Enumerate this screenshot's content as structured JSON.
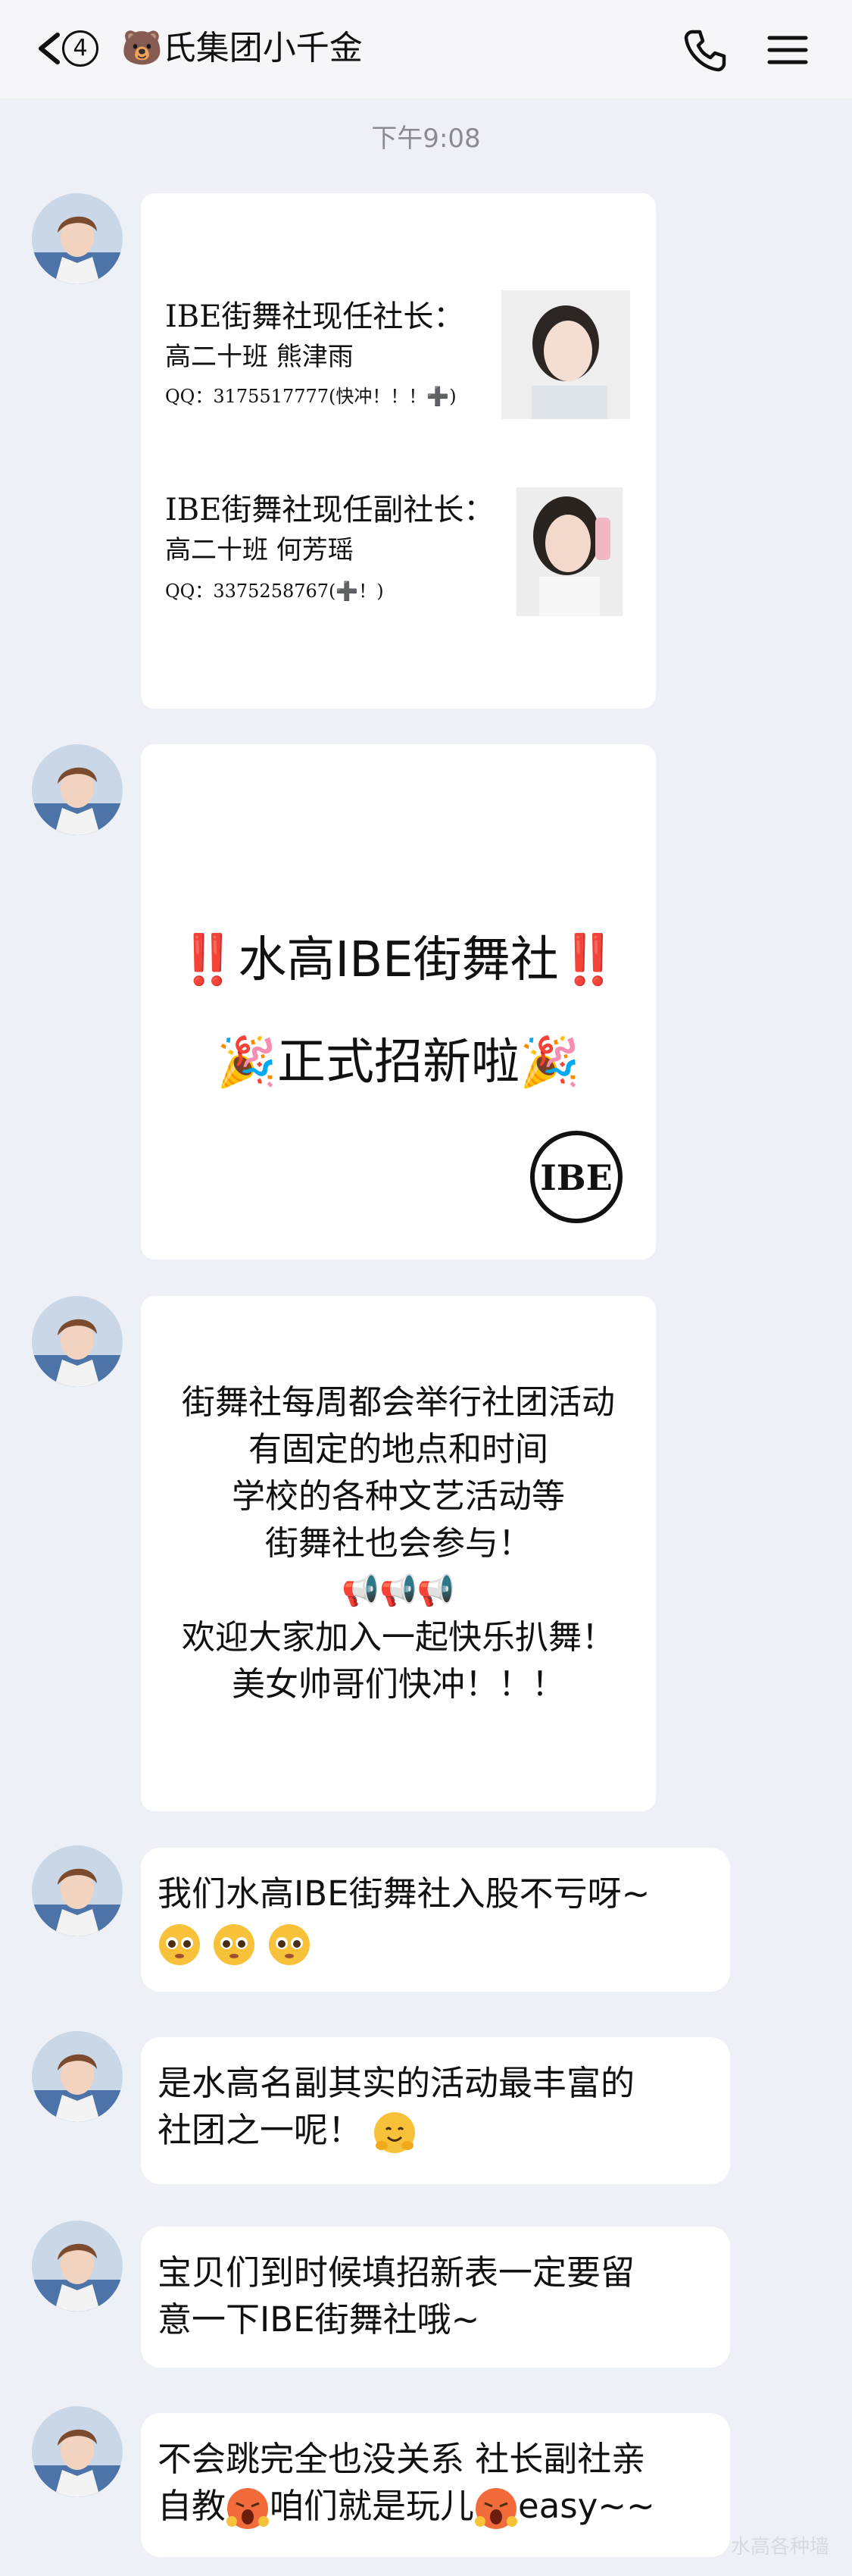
{
  "header": {
    "unread_count": "4",
    "title": "🐻氏集团小千金"
  },
  "timestamp": "下午9:08",
  "card1": {
    "president": {
      "title": "IBE街舞社现任社长：",
      "line2": "高二十班 熊津雨",
      "line3": "QQ：3175517777(快冲！！！➕)"
    },
    "vice": {
      "title": "IBE街舞社现任副社长：",
      "line2": "高二十班 何芳瑶",
      "line3": "QQ：3375258767(➕！)"
    }
  },
  "card2": {
    "headline": "‼️水高IBE街舞社‼️",
    "subline": "🎉正式招新啦🎉",
    "logo_text": "IBE"
  },
  "card3": {
    "lines": [
      "街舞社每周都会举行社团活动",
      "有固定的地点和时间",
      "学校的各种文艺活动等",
      "街舞社也会参与！",
      "📢📢📢",
      "欢迎大家加入一起快乐扒舞！",
      "美女帅哥们快冲！！！"
    ]
  },
  "messages": [
    {
      "line1": "我们水高IBE街舞社入股不亏呀~"
    },
    {
      "line1": "是水高名副其实的活动最丰富的",
      "line2": "社团之一呢！"
    },
    {
      "line1": "宝贝们到时候填招新表一定要留",
      "line2": "意一下IBE街舞社哦~"
    },
    {
      "line1": "不会跳完全也没关系 社长副社亲",
      "line2a": "自教",
      "line2b": "咱们就是玩儿",
      "line2c": "easy~~"
    }
  ],
  "watermark": "水高各种墙"
}
